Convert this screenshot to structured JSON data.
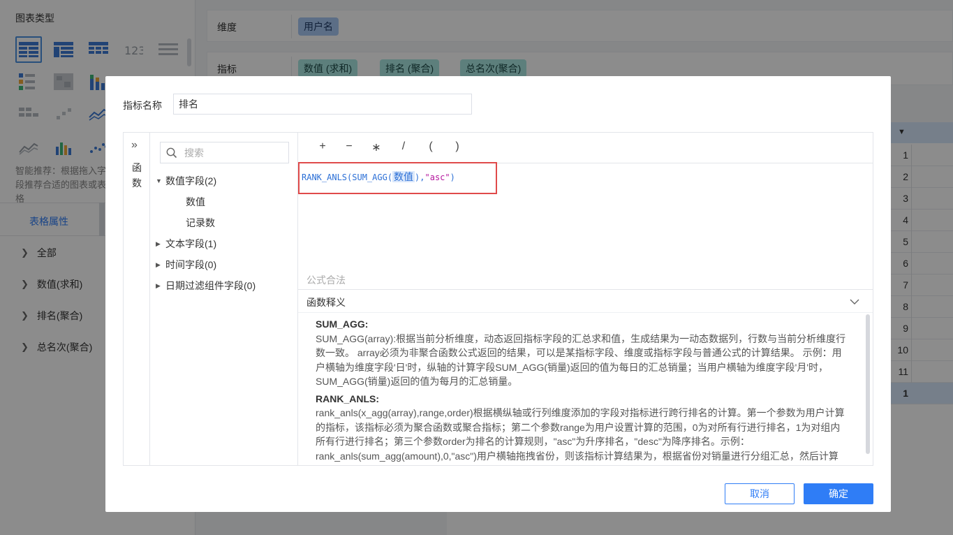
{
  "left": {
    "section_title": "图表类型",
    "recommend_text": "智能推荐：根据拖入字段推荐合适的图表或表格",
    "tab_label": "表格属性",
    "props": [
      {
        "label": "全部"
      },
      {
        "label": "数值(求和)"
      },
      {
        "label": "排名(聚合)"
      },
      {
        "label": "总名次(聚合)"
      }
    ]
  },
  "top": {
    "dimension_label": "维度",
    "dimension_pill": "用户名",
    "indicator_label": "指标",
    "indicator_pills": [
      "数值 (求和)",
      "排名 (聚合)",
      "总名次(聚合)"
    ]
  },
  "table": {
    "row_numbers": [
      "1",
      "2",
      "3",
      "4",
      "5",
      "6",
      "7",
      "8",
      "9",
      "10",
      "11"
    ],
    "total_value": "1"
  },
  "modal": {
    "name_label": "指标名称",
    "name_value": "排名",
    "func_label": "函数",
    "search_placeholder": "搜索",
    "tree": {
      "numeric": "数值字段(2)",
      "numeric_children": [
        "数值",
        "记录数"
      ],
      "text": "文本字段(1)",
      "time": "时间字段(0)",
      "date_filter": "日期过滤组件字段(0)"
    },
    "operators": [
      "+",
      "−",
      "∗",
      "/",
      "(",
      ")"
    ],
    "formula": {
      "prefix": "RANK_ANLS(SUM_AGG(",
      "field": "数值",
      "middle": "),",
      "string": "\"asc\"",
      "suffix": ")"
    },
    "valid_text": "公式合法",
    "desc_title": "函数释义",
    "desc": {
      "sum_agg_title": "SUM_AGG:",
      "sum_agg_text": "SUM_AGG(array):根据当前分析维度，动态返回指标字段的汇总求和值，生成结果为一动态数据列，行数与当前分析维度行数一致。 array必须为非聚合函数公式返回的结果，可以是某指标字段、维度或指标字段与普通公式的计算结果。 示例：用户横轴为维度字段'日'时，纵轴的计算字段SUM_AGG(销量)返回的值为每日的汇总销量；当用户横轴为维度字段'月'时，SUM_AGG(销量)返回的值为每月的汇总销量。",
      "rank_title": "RANK_ANLS:",
      "rank_text": "rank_anls(x_agg(array),range,order)根据横纵轴或行列维度添加的字段对指标进行跨行排名的计算。第一个参数为用户计算的指标，该指标必须为聚合函数或聚合指标；第二个参数range为用户设置计算的范围，0为对所有行进行排名，1为对组内所有行进行排名；第三个参数order为排名的计算规则，\"asc\"为升序排名，\"desc\"为降序排名。示例：rank_anls(sum_agg(amount),0,\"asc\")用户横轴拖拽省份，则该指标计算结果为，根据省份对销量进行分组汇总，然后计算每个省份的销量在所有省份中的升序排名情况。"
    },
    "cancel_label": "取消",
    "ok_label": "确定"
  },
  "colors": {
    "accent": "#2f7df6",
    "dimension_pill": "#a8c8f5",
    "indicator_pill": "#a9e7e2",
    "highlight_border": "#e04a4a"
  }
}
